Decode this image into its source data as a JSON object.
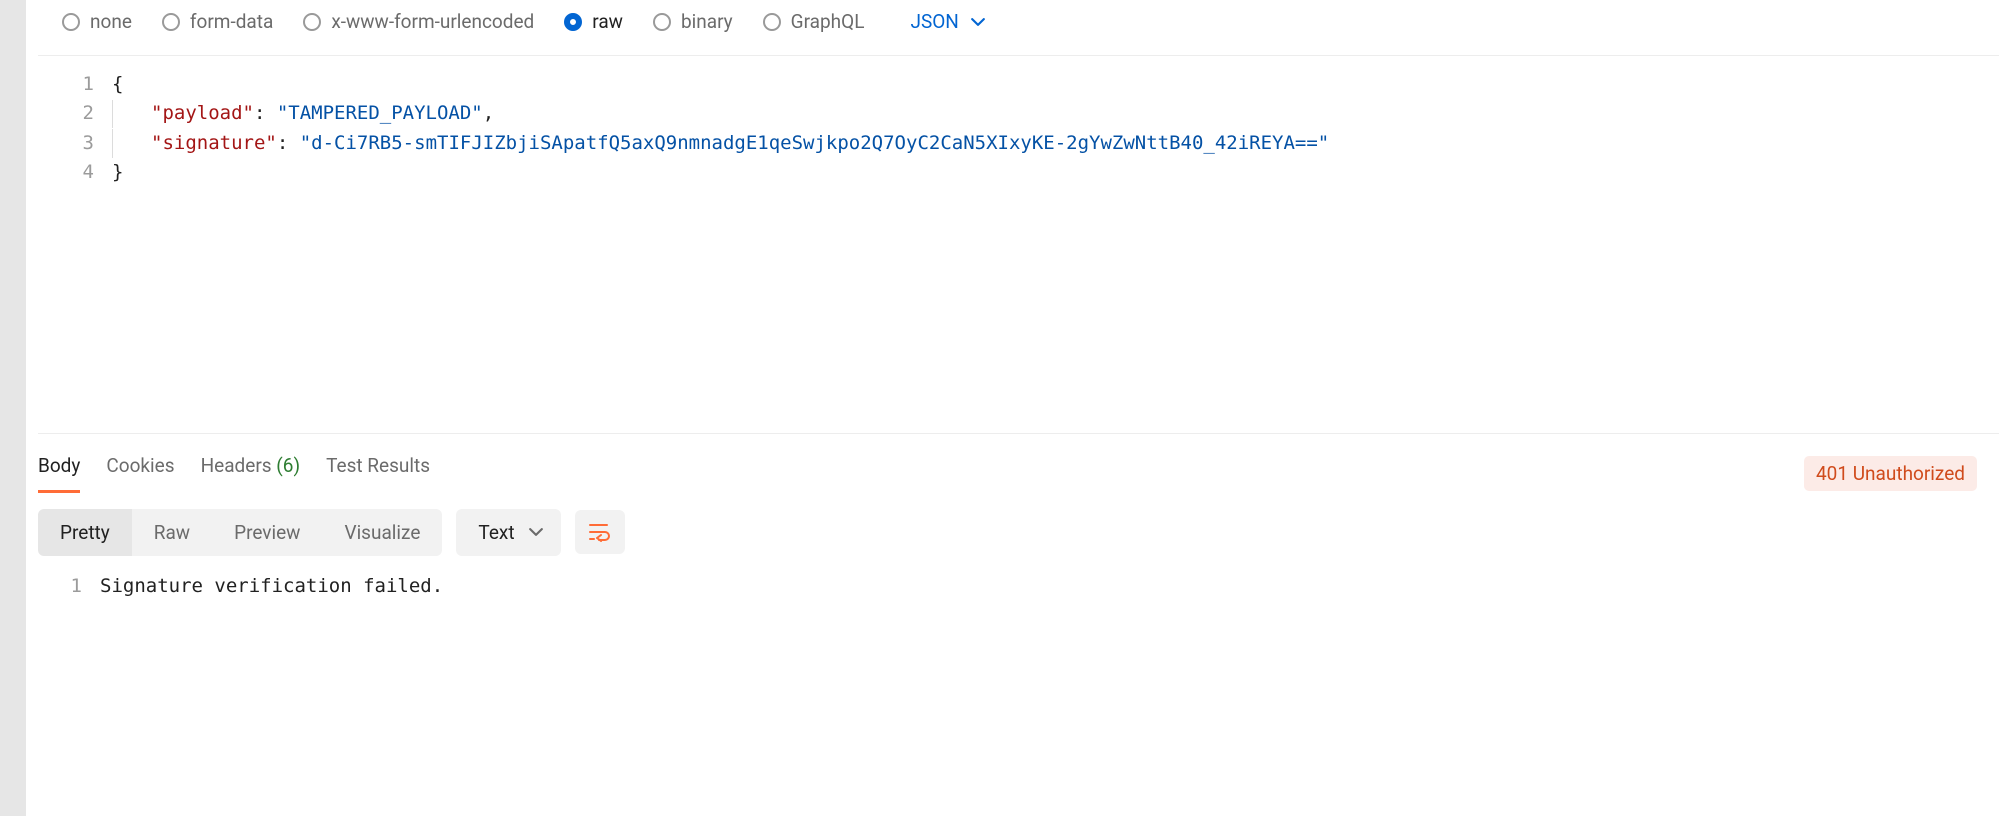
{
  "request": {
    "body_types": [
      {
        "id": "none",
        "label": "none",
        "selected": false
      },
      {
        "id": "form-data",
        "label": "form-data",
        "selected": false
      },
      {
        "id": "xwww",
        "label": "x-www-form-urlencoded",
        "selected": false
      },
      {
        "id": "raw",
        "label": "raw",
        "selected": true
      },
      {
        "id": "binary",
        "label": "binary",
        "selected": false
      },
      {
        "id": "graphql",
        "label": "GraphQL",
        "selected": false
      }
    ],
    "body_format": "JSON",
    "body_lines": {
      "l1_open": "{",
      "l2_key": "\"payload\"",
      "l2_val": "\"TAMPERED_PAYLOAD\"",
      "l3_key": "\"signature\"",
      "l3_val": "\"d-Ci7RB5-smTIFJIZbjiSApatfQ5axQ9nmnadgE1qeSwjkpo2Q7OyC2CaN5XIxyKE-2gYwZwNttB40_42iREYA==\"",
      "l4_close": "}",
      "n1": "1",
      "n2": "2",
      "n3": "3",
      "n4": "4"
    }
  },
  "response": {
    "tabs": {
      "body": "Body",
      "cookies": "Cookies",
      "headers_label": "Headers",
      "headers_count": "(6)",
      "tests": "Test Results"
    },
    "status_text": "401 Unauthorized",
    "view_modes": {
      "pretty": "Pretty",
      "raw": "Raw",
      "preview": "Preview",
      "visualize": "Visualize"
    },
    "content_format": "Text",
    "body_lines": {
      "n1": "1",
      "l1": "Signature verification failed."
    }
  }
}
